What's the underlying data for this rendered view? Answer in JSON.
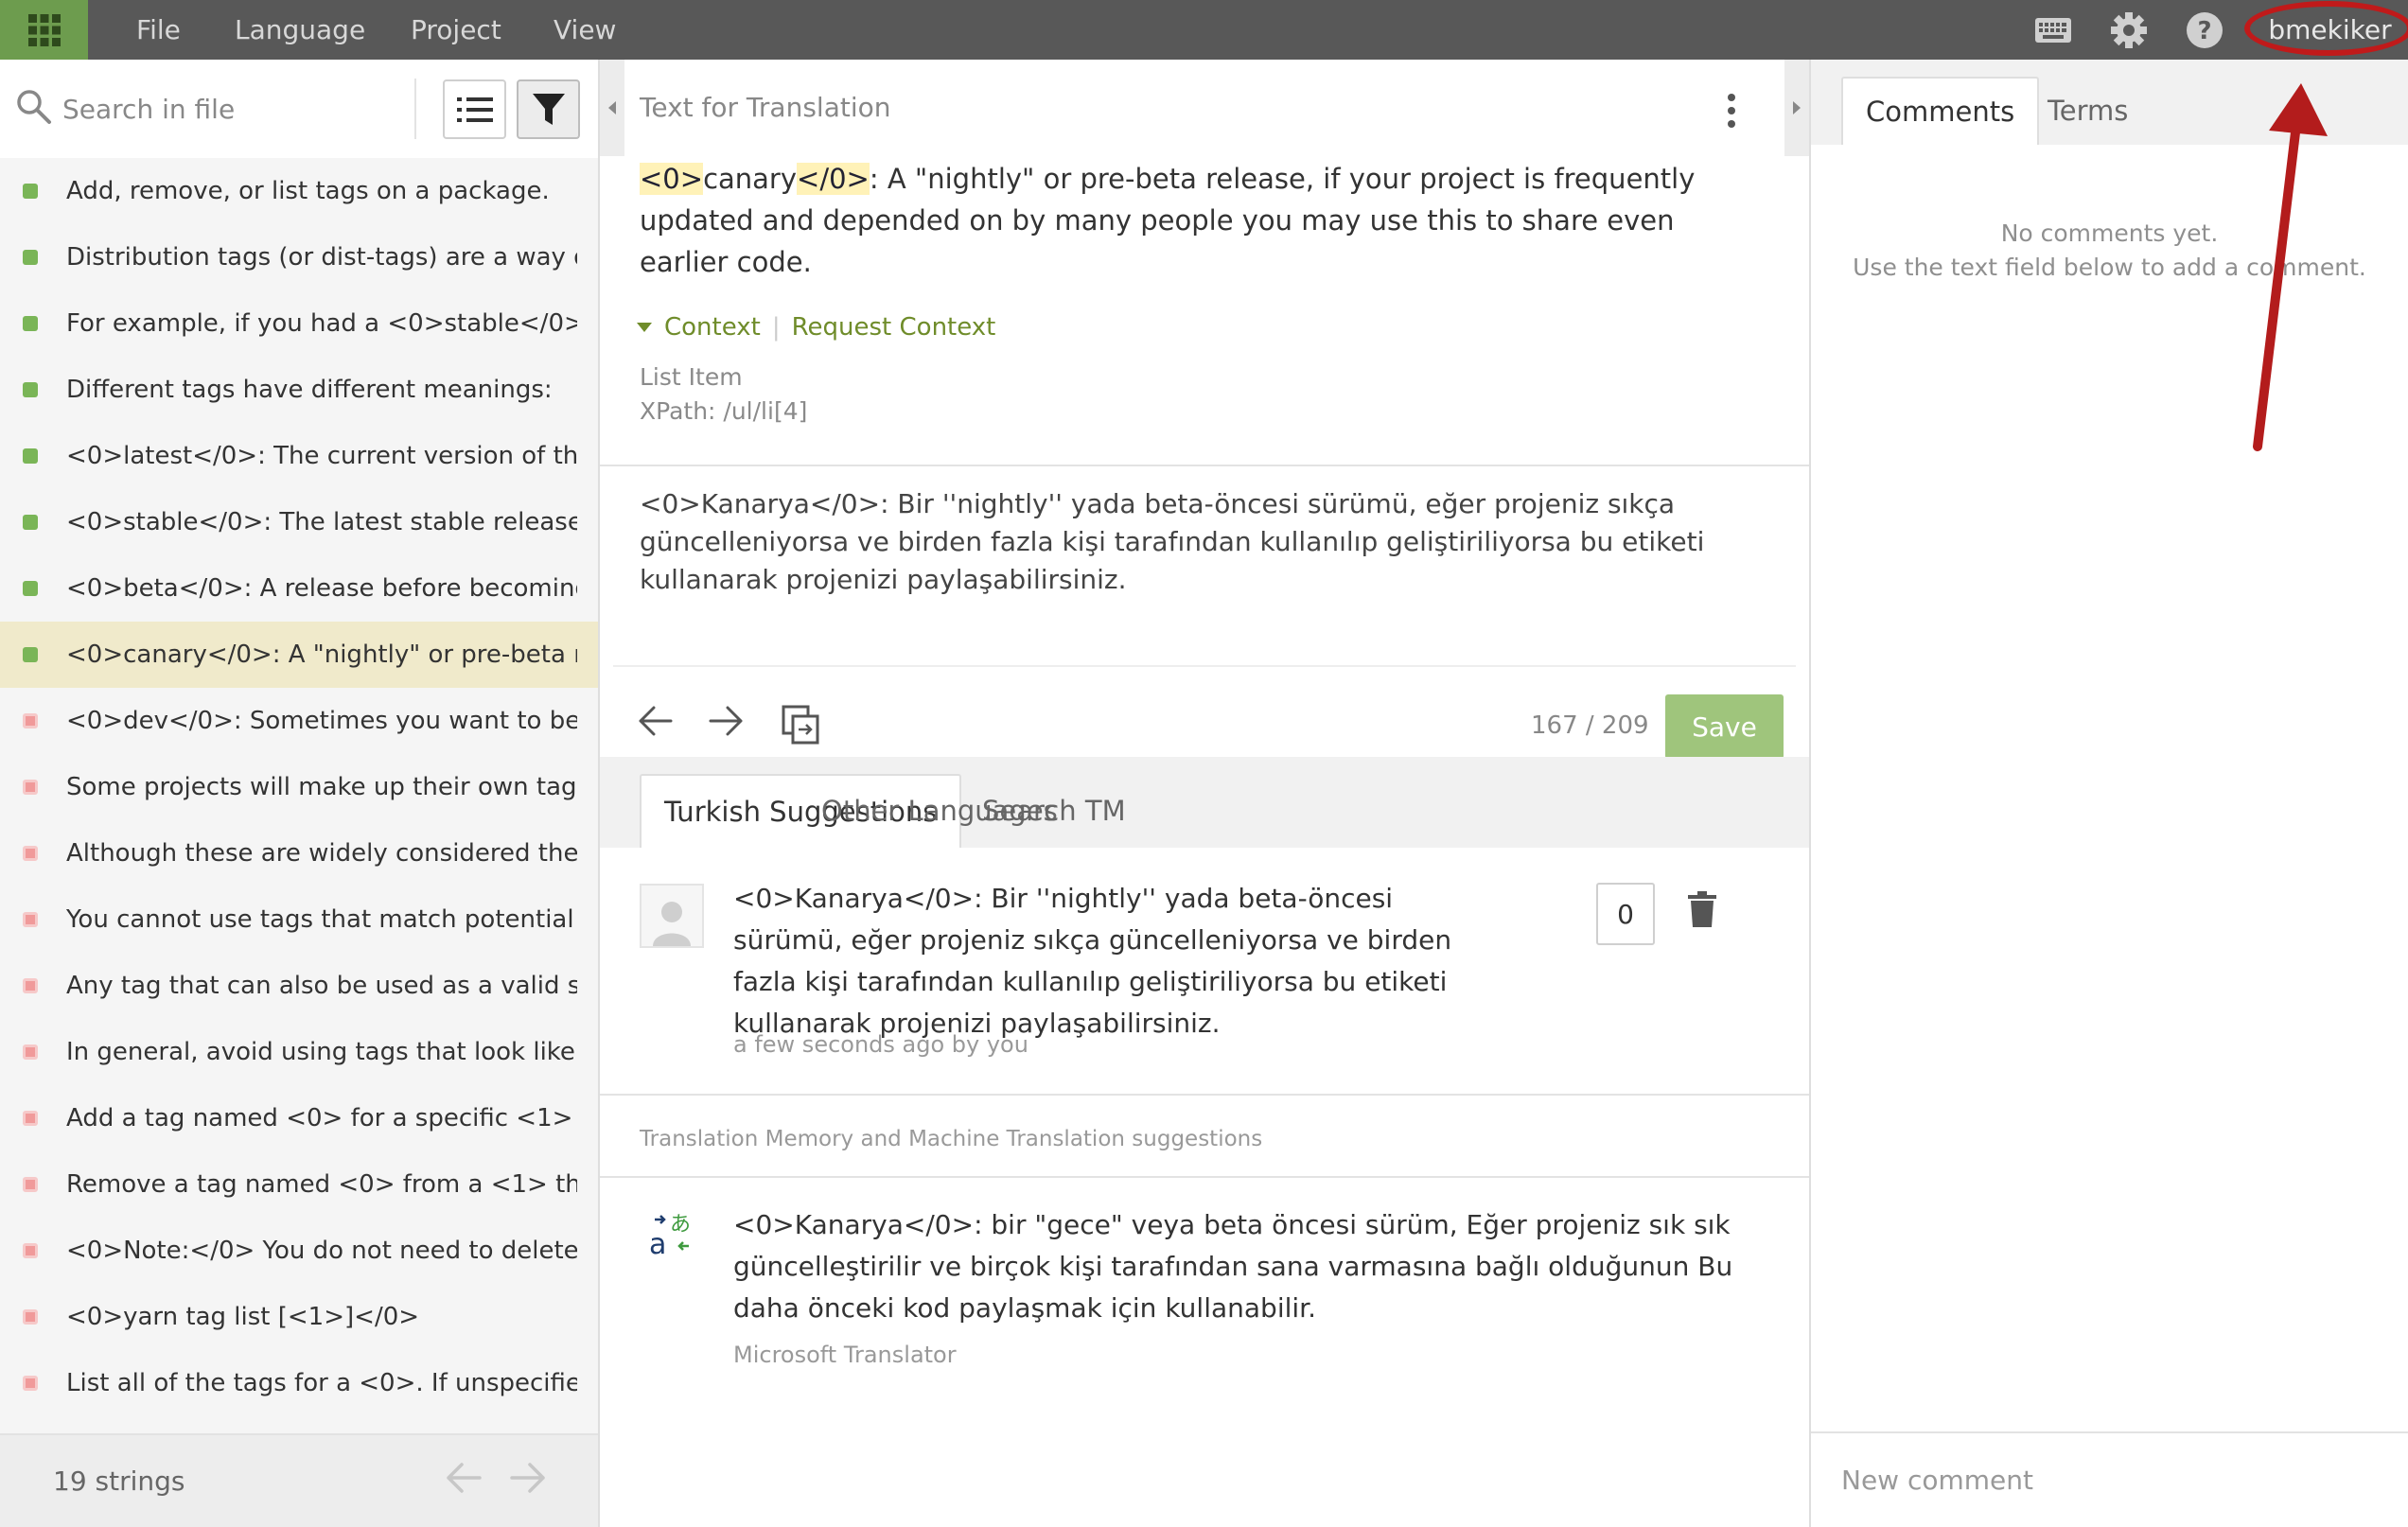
{
  "menu": {
    "file": "File",
    "language": "Language",
    "project": "Project",
    "view": "View"
  },
  "user": {
    "name": "bmekiker"
  },
  "icons": {
    "apps": "apps-grid-icon",
    "keyboard": "keyboard-icon",
    "settings": "gear-icon",
    "help": "help-icon"
  },
  "search": {
    "placeholder": "Search in file"
  },
  "strings": [
    {
      "text": "Add, remove, or list tags on a package.",
      "status": "translated"
    },
    {
      "text": "Distribution tags (or dist-tags) are a way of ...",
      "status": "translated"
    },
    {
      "text": "For example, if you had a <0>stable</0> re...",
      "status": "translated"
    },
    {
      "text": "Different tags have different meanings:",
      "status": "translated"
    },
    {
      "text": "<0>latest</0>: The current version of the p...",
      "status": "translated"
    },
    {
      "text": "<0>stable</0>: The latest stable release of ...",
      "status": "translated"
    },
    {
      "text": "<0>beta</0>: A release before becoming la...",
      "status": "translated"
    },
    {
      "text": "<0>canary</0>: A \"nightly\" or pre-beta rele...",
      "status": "translated",
      "selected": true
    },
    {
      "text": "<0>dev</0>: Sometimes you want to be ab...",
      "status": "missing"
    },
    {
      "text": "Some projects will make up their own tags ...",
      "status": "missing"
    },
    {
      "text": "Although these are widely considered the \"...",
      "status": "missing"
    },
    {
      "text": "You cannot use tags that match potential v...",
      "status": "missing"
    },
    {
      "text": "Any tag that can also be used as a valid se...",
      "status": "missing"
    },
    {
      "text": "In general, avoid using tags that look like v...",
      "status": "missing"
    },
    {
      "text": "Add a tag named <0> for a specific <1> of ...",
      "status": "missing"
    },
    {
      "text": "Remove a tag named <0> from a <1> that i...",
      "status": "missing"
    },
    {
      "text": "<0>Note:</0> You do not need to delete a ...",
      "status": "missing"
    },
    {
      "text": "<0>yarn tag list [<1>]</0>",
      "status": "missing"
    },
    {
      "text": "List all of the tags for a <0>. If unspecified ...",
      "status": "missing"
    }
  ],
  "strings_footer": {
    "count": "19 strings"
  },
  "editor": {
    "title": "Text for Translation",
    "source": {
      "tag_open": "<0>",
      "word": "canary",
      "tag_close": "</0>",
      "rest": ": A \"nightly\" or pre-beta release, if your project is frequently updated and depended on by many people you may use this to share even earlier code."
    },
    "context_label": "Context",
    "request_context": "Request Context",
    "context_type": "List Item",
    "xpath": "XPath: /ul/li[4]",
    "translation": "<0>Kanarya</0>: Bir ''nightly'' yada beta-öncesi sürümü, eğer projeniz sıkça güncelleniyorsa ve birden fazla kişi tarafından kullanılıp geliştiriliyorsa bu etiketi kullanarak projenizi paylaşabilirsiniz.",
    "char_count": "167 / 209",
    "save_label": "Save"
  },
  "suggestion_tabs": [
    "Turkish Suggestions",
    "Other Languages",
    "Search TM"
  ],
  "suggestion": {
    "text": "<0>Kanarya</0>: Bir ''nightly'' yada beta-öncesi sürümü, eğer projeniz sıkça güncelleniyorsa ve birden fazla kişi tarafından kullanılıp geliştiriliyorsa bu etiketi kullanarak projenizi paylaşabilirsiniz.",
    "meta": "a few seconds ago by you",
    "votes": "0"
  },
  "tm_section": {
    "label": "Translation Memory and Machine Translation suggestions",
    "text": "<0>Kanarya</0>: bir \"gece\" veya beta öncesi sürüm, Eğer projeniz sık sık güncelleştirilir ve birçok kişi tarafından sana varmasına bağlı olduğunun Bu daha önceki kod paylaşmak için kullanabilir.",
    "source": "Microsoft Translator"
  },
  "comments": {
    "tabs": [
      "Comments",
      "Terms"
    ],
    "empty_line1": "No comments yet.",
    "empty_line2": "Use the text field below to add a comment.",
    "new_placeholder": "New comment"
  },
  "colors": {
    "accent": "#6d9c4e",
    "topbar": "#585858",
    "annotation": "#c01a1a"
  }
}
